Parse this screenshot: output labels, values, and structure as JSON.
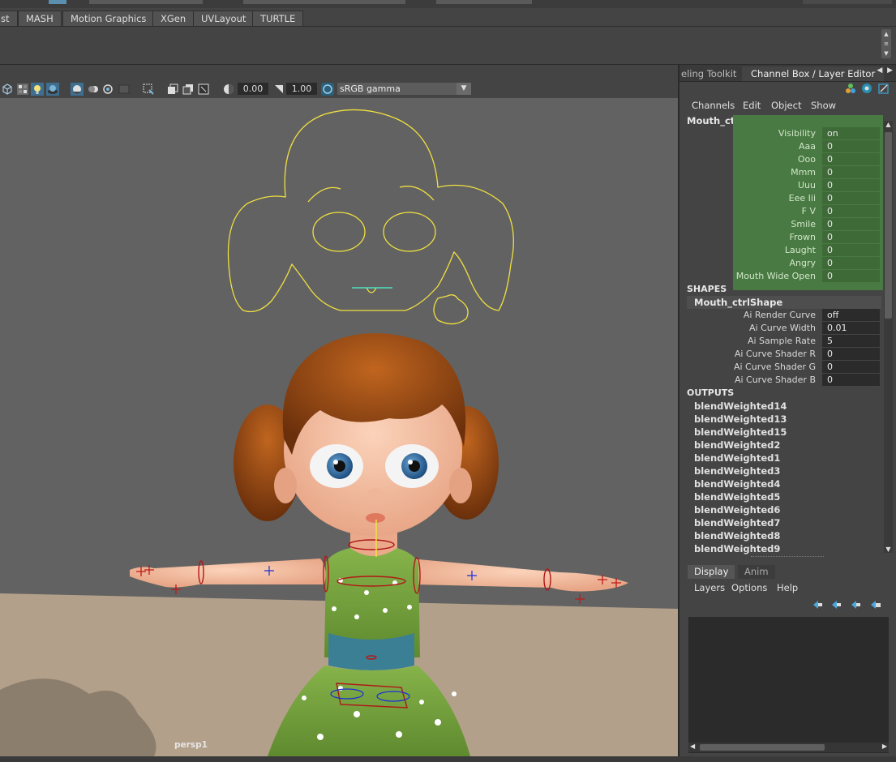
{
  "shelf_tabs": [
    "st",
    "MASH",
    "Motion Graphics",
    "XGen",
    "UVLayout",
    "TURTLE"
  ],
  "viewport": {
    "exposure_value": "0.00",
    "gamma_value": "1.00",
    "color_space": "sRGB gamma",
    "camera_label": "persp1"
  },
  "right_panel": {
    "tabs": [
      "eling Toolkit",
      "Channel Box / Layer Editor"
    ],
    "menu": [
      "Channels",
      "Edit",
      "Object",
      "Show"
    ],
    "object_name": "Mouth_ctrl",
    "channels": [
      {
        "label": "Visibility",
        "value": "on"
      },
      {
        "label": "Aaa",
        "value": "0"
      },
      {
        "label": "Ooo",
        "value": "0"
      },
      {
        "label": "Mmm",
        "value": "0"
      },
      {
        "label": "Uuu",
        "value": "0"
      },
      {
        "label": "Eee Iii",
        "value": "0"
      },
      {
        "label": "F V",
        "value": "0"
      },
      {
        "label": "Smile",
        "value": "0"
      },
      {
        "label": "Frown",
        "value": "0"
      },
      {
        "label": "Laught",
        "value": "0"
      },
      {
        "label": "Angry",
        "value": "0"
      },
      {
        "label": "Mouth Wide Open",
        "value": "0"
      }
    ],
    "shapes_header": "SHAPES",
    "shape_name": "Mouth_ctrlShape",
    "shape_attrs": [
      {
        "label": "Ai Render Curve",
        "value": "off"
      },
      {
        "label": "Ai Curve Width",
        "value": "0.01"
      },
      {
        "label": "Ai Sample Rate",
        "value": "5"
      },
      {
        "label": "Ai Curve Shader R",
        "value": "0"
      },
      {
        "label": "Ai Curve Shader G",
        "value": "0"
      },
      {
        "label": "Ai Curve Shader B",
        "value": "0"
      }
    ],
    "outputs_header": "OUTPUTS",
    "outputs": [
      "blendWeighted14",
      "blendWeighted13",
      "blendWeighted15",
      "blendWeighted2",
      "blendWeighted1",
      "blendWeighted3",
      "blendWeighted4",
      "blendWeighted5",
      "blendWeighted6",
      "blendWeighted7",
      "blendWeighted8",
      "blendWeighted9"
    ]
  },
  "layer_editor": {
    "tabs": [
      "Display",
      "Anim"
    ],
    "menu": [
      "Layers",
      "Options",
      "Help"
    ]
  },
  "colors": {
    "channel_highlight": "#4a7a43",
    "control_curve": "#f0e040",
    "viewport_bg": "#626262",
    "floor": "#b3a08a"
  }
}
